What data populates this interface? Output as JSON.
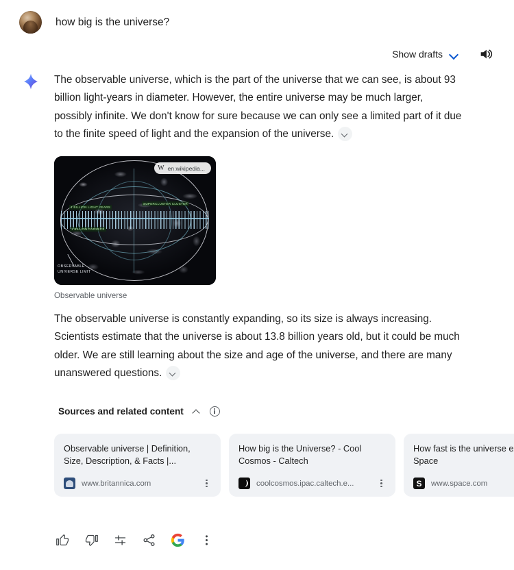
{
  "prompt": {
    "text": "how big is the universe?",
    "avatar_name": "user-profile-photo"
  },
  "toolbar": {
    "show_drafts_label": "Show drafts",
    "speaker_icon": "volume-up-icon",
    "chevron_icon": "chevron-down-icon"
  },
  "answer": {
    "sparkle_icon": "gemini-sparkle-icon",
    "paragraph1": "The observable universe, which is the part of the universe that we can see, is about 93 billion light-years in diameter. However, the entire universe may be much larger, possibly infinite. We don't know for sure because we can only see a limited part of it due to the finite speed of light and the expansion of the universe.",
    "paragraph2": "The observable universe is constantly expanding, so its size is always increasing. Scientists estimate that the universe is about 13.8 billion years old, but it could be much older. We are still learning about the size and age of the universe, and there are many unanswered questions."
  },
  "image_card": {
    "caption": "Observable universe",
    "badge_mark": "W",
    "badge_text": "en.wikipedia...",
    "overlay_labels": {
      "label_a": "1 BILLION LIGHT YEARS",
      "label_b": "SUPERCLUSTER CLUSTER",
      "label_c": "1 BILLION PARSECS",
      "limit": "OBSERVABLE\nUNIVERSE LIMIT"
    }
  },
  "sources": {
    "title": "Sources and related content",
    "collapse_icon": "chevron-up-icon",
    "info_icon": "info-icon",
    "cards": [
      {
        "title": "Observable universe | Definition, Size, Description, & Facts |...",
        "domain": "www.britannica.com",
        "favicon": "britannica-favicon"
      },
      {
        "title": "How big is the Universe? - Cool Cosmos - Caltech",
        "domain": "coolcosmos.ipac.caltech.e...",
        "favicon": "caltech-favicon"
      },
      {
        "title": "How fast is the universe expanding? | Space",
        "domain": "www.space.com",
        "favicon": "space-favicon"
      }
    ]
  },
  "actions": [
    {
      "name": "thumb-up-icon",
      "label": "Good response"
    },
    {
      "name": "thumb-down-icon",
      "label": "Bad response"
    },
    {
      "name": "tune-icon",
      "label": "Modify response"
    },
    {
      "name": "share-icon",
      "label": "Share & export"
    },
    {
      "name": "google-logo-icon",
      "label": "Google it"
    },
    {
      "name": "more-vert-icon",
      "label": "More"
    }
  ],
  "colors": {
    "accent_blue": "#0b57d0",
    "text_primary": "#1f1f1f",
    "text_secondary": "#5f6368",
    "card_bg": "#f0f2f5"
  }
}
